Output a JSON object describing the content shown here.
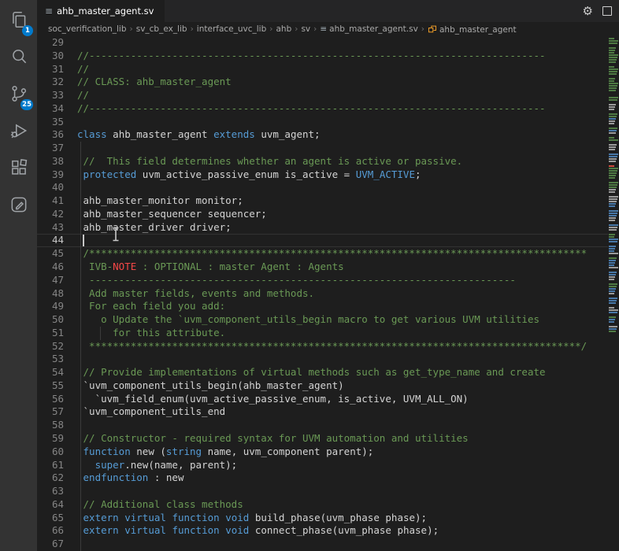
{
  "icons": {
    "sv_file_glyph": "≡",
    "gear_glyph": "⚙",
    "crumb_separator": "›"
  },
  "activity_bar": {
    "items": [
      {
        "id": "explorer",
        "badge": "1"
      },
      {
        "id": "search",
        "badge": ""
      },
      {
        "id": "source-control",
        "badge": "25"
      },
      {
        "id": "run-debug",
        "badge": ""
      },
      {
        "id": "extensions",
        "badge": ""
      },
      {
        "id": "pencil-box",
        "badge": ""
      }
    ]
  },
  "tab": {
    "title": "ahb_master_agent.sv",
    "modified": true
  },
  "breadcrumbs": {
    "path": [
      "soc_verification_lib",
      "sv_cb_ex_lib",
      "interface_uvc_lib",
      "ahb",
      "sv"
    ],
    "file": "ahb_master_agent.sv",
    "symbol": "ahb_master_agent"
  },
  "colors": {
    "comment": "#6a9955",
    "keyword": "#569cd6",
    "plain_text": "#d4d4d4",
    "alert": "#f44747",
    "badge": "#007acc",
    "class_symbol": "#ee9d28"
  },
  "editor": {
    "active_line": 44,
    "lines": [
      {
        "n": 29,
        "t": []
      },
      {
        "n": 30,
        "t": [
          [
            "c",
            "//-----------------------------------------------------------------------------"
          ]
        ]
      },
      {
        "n": 31,
        "t": [
          [
            "c",
            "//"
          ]
        ]
      },
      {
        "n": 32,
        "t": [
          [
            "c",
            "// CLASS: ahb_master_agent"
          ]
        ]
      },
      {
        "n": 33,
        "t": [
          [
            "c",
            "//"
          ]
        ]
      },
      {
        "n": 34,
        "t": [
          [
            "c",
            "//-----------------------------------------------------------------------------"
          ]
        ]
      },
      {
        "n": 35,
        "t": []
      },
      {
        "n": 36,
        "t": [
          [
            "k",
            "class"
          ],
          [
            "p",
            " ahb_master_agent "
          ],
          [
            "k",
            "extends"
          ],
          [
            "p",
            " uvm_agent;"
          ]
        ]
      },
      {
        "n": 37,
        "t": []
      },
      {
        "n": 38,
        "t": [
          [
            "c",
            " //  This field determines whether an agent is active or passive."
          ]
        ]
      },
      {
        "n": 39,
        "t": [
          [
            "p",
            " "
          ],
          [
            "k",
            "protected"
          ],
          [
            "p",
            " uvm_active_passive_enum is_active = "
          ],
          [
            "k",
            "UVM_ACTIVE"
          ],
          [
            "p",
            ";"
          ]
        ]
      },
      {
        "n": 40,
        "t": []
      },
      {
        "n": 41,
        "t": [
          [
            "p",
            " ahb_master_monitor monitor;"
          ]
        ]
      },
      {
        "n": 42,
        "t": [
          [
            "p",
            " ahb_master_sequencer sequencer;"
          ]
        ]
      },
      {
        "n": 43,
        "t": [
          [
            "p",
            " ahb_master_driver driver;"
          ]
        ]
      },
      {
        "n": 44,
        "t": []
      },
      {
        "n": 45,
        "t": [
          [
            "c",
            " /************************************************************************************"
          ]
        ]
      },
      {
        "n": 46,
        "t": [
          [
            "c",
            "  IVB-"
          ],
          [
            "a",
            "NOTE"
          ],
          [
            "c",
            " : OPTIONAL : master Agent : Agents"
          ]
        ]
      },
      {
        "n": 47,
        "t": [
          [
            "c",
            "  ------------------------------------------------------------------------"
          ]
        ]
      },
      {
        "n": 48,
        "t": [
          [
            "c",
            "  Add master fields, events and methods."
          ]
        ]
      },
      {
        "n": 49,
        "t": [
          [
            "c",
            "  For each field you add:"
          ]
        ]
      },
      {
        "n": 50,
        "t": [
          [
            "c",
            "    o Update the `uvm_component_utils_begin macro to get various UVM utilities"
          ]
        ]
      },
      {
        "n": 51,
        "t": [
          [
            "c",
            "      for this attribute."
          ]
        ]
      },
      {
        "n": 52,
        "t": [
          [
            "c",
            "  ***********************************************************************************/"
          ]
        ]
      },
      {
        "n": 53,
        "t": []
      },
      {
        "n": 54,
        "t": [
          [
            "c",
            " // Provide implementations of virtual methods such as get_type_name and create"
          ]
        ]
      },
      {
        "n": 55,
        "t": [
          [
            "p",
            " `uvm_component_utils_begin(ahb_master_agent)"
          ]
        ]
      },
      {
        "n": 56,
        "t": [
          [
            "p",
            "   `uvm_field_enum(uvm_active_passive_enum, is_active, UVM_ALL_ON)"
          ]
        ]
      },
      {
        "n": 57,
        "t": [
          [
            "p",
            " `uvm_component_utils_end"
          ]
        ]
      },
      {
        "n": 58,
        "t": []
      },
      {
        "n": 59,
        "t": [
          [
            "c",
            " // Constructor - required syntax for UVM automation and utilities"
          ]
        ]
      },
      {
        "n": 60,
        "t": [
          [
            "p",
            " "
          ],
          [
            "k",
            "function"
          ],
          [
            "p",
            " new ("
          ],
          [
            "k",
            "string"
          ],
          [
            "p",
            " name, uvm_component parent);"
          ]
        ]
      },
      {
        "n": 61,
        "t": [
          [
            "p",
            "   "
          ],
          [
            "k",
            "super"
          ],
          [
            "p",
            ".new(name, parent);"
          ]
        ]
      },
      {
        "n": 62,
        "t": [
          [
            "p",
            " "
          ],
          [
            "k",
            "endfunction"
          ],
          [
            "p",
            " : new"
          ]
        ]
      },
      {
        "n": 63,
        "t": []
      },
      {
        "n": 64,
        "t": [
          [
            "c",
            " // Additional class methods"
          ]
        ]
      },
      {
        "n": 65,
        "t": [
          [
            "p",
            " "
          ],
          [
            "k",
            "extern"
          ],
          [
            "p",
            " "
          ],
          [
            "k",
            "virtual"
          ],
          [
            "p",
            " "
          ],
          [
            "k",
            "function"
          ],
          [
            "p",
            " "
          ],
          [
            "k",
            "void"
          ],
          [
            "p",
            " build_phase(uvm_phase phase);"
          ]
        ]
      },
      {
        "n": 66,
        "t": [
          [
            "p",
            " "
          ],
          [
            "k",
            "extern"
          ],
          [
            "p",
            " "
          ],
          [
            "k",
            "virtual"
          ],
          [
            "p",
            " "
          ],
          [
            "k",
            "function"
          ],
          [
            "p",
            " "
          ],
          [
            "k",
            "void"
          ],
          [
            "p",
            " connect_phase(uvm_phase phase);"
          ]
        ]
      },
      {
        "n": 67,
        "t": []
      }
    ]
  },
  "minimap": {
    "runs": [
      [
        "g",
        3
      ],
      [
        "_",
        1
      ],
      [
        "g",
        7
      ],
      [
        "_",
        1
      ],
      [
        "g",
        4
      ],
      [
        "_",
        1
      ],
      [
        "g",
        6
      ],
      [
        "_",
        2
      ],
      [
        "g",
        2
      ],
      [
        "_",
        1
      ],
      [
        "w",
        3
      ],
      [
        "_",
        1
      ],
      [
        "g",
        2
      ],
      [
        "b",
        1
      ],
      [
        "w",
        2
      ],
      [
        "_",
        1
      ],
      [
        "g",
        1
      ],
      [
        "b",
        1
      ],
      [
        "w",
        1
      ],
      [
        "_",
        1
      ],
      [
        "g",
        2
      ],
      [
        "_",
        1
      ],
      [
        "w",
        3
      ],
      [
        "_",
        1
      ],
      [
        "b",
        2
      ],
      [
        "w",
        2
      ],
      [
        "_",
        1
      ],
      [
        "o",
        1
      ],
      [
        "g",
        5
      ],
      [
        "_",
        1
      ],
      [
        "g",
        3
      ],
      [
        "w",
        2
      ],
      [
        "_",
        1
      ],
      [
        "w",
        3
      ],
      [
        "b",
        2
      ],
      [
        "_",
        1
      ],
      [
        "b",
        3
      ],
      [
        "w",
        2
      ],
      [
        "_",
        1
      ],
      [
        "b",
        1
      ],
      [
        "w",
        2
      ],
      [
        "_",
        1
      ],
      [
        "g",
        2
      ],
      [
        "b",
        2
      ],
      [
        "_",
        1
      ],
      [
        "b",
        3
      ],
      [
        "w",
        1
      ],
      [
        "_",
        1
      ],
      [
        "g",
        1
      ],
      [
        "b",
        3
      ],
      [
        "w",
        1
      ],
      [
        "_",
        1
      ],
      [
        "b",
        2
      ],
      [
        "w",
        2
      ],
      [
        "_",
        1
      ],
      [
        "g",
        2
      ],
      [
        "b",
        2
      ],
      [
        "w",
        1
      ],
      [
        "_",
        1
      ],
      [
        "b",
        3
      ],
      [
        "_",
        1
      ],
      [
        "w",
        2
      ],
      [
        "b",
        1
      ],
      [
        "_",
        1
      ],
      [
        "g",
        1
      ],
      [
        "b",
        2
      ],
      [
        "_",
        1
      ],
      [
        "w",
        1
      ],
      [
        "b",
        1
      ],
      [
        "g",
        1
      ]
    ]
  }
}
